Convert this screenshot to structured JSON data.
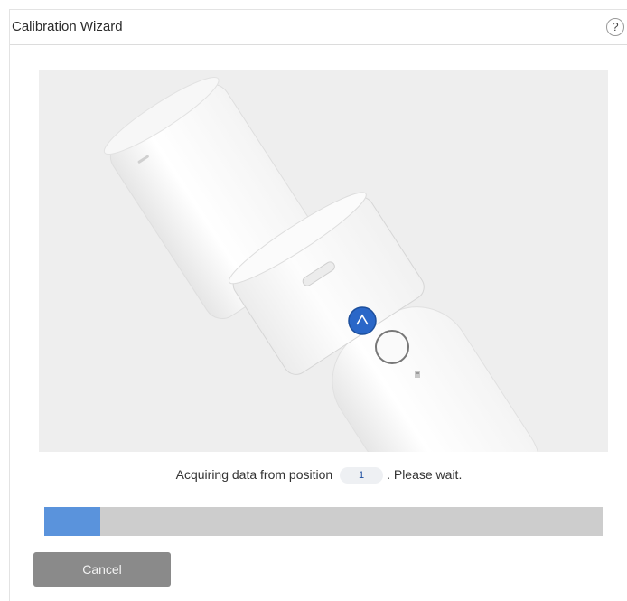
{
  "dialog": {
    "title": "Calibration Wizard",
    "help_label": "?"
  },
  "status": {
    "prefix": "Acquiring data from position",
    "position": "1",
    "suffix": ". Please wait."
  },
  "progress": {
    "fraction": 0.1
  },
  "buttons": {
    "cancel_label": "Cancel"
  },
  "colors": {
    "progress_fill": "#5a93dc",
    "progress_track": "#cdcdcd",
    "button_gray": "#8a8a8a",
    "indicator_blue": "#2a67c8"
  },
  "illustration": {
    "icon": "calibration-probe-illustration"
  }
}
